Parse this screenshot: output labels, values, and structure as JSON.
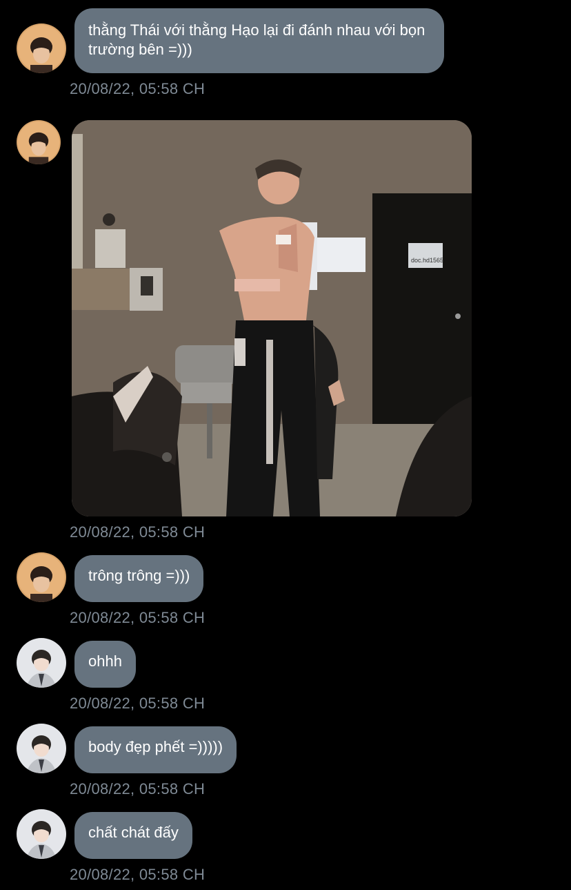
{
  "colors": {
    "background": "#000000",
    "bubble": "#66737f",
    "timestamp": "#7f8a95",
    "text": "#ffffff"
  },
  "messages": [
    {
      "sender": "avatar-orange",
      "text": "thằng Thái với thằng Hạo lại đi đánh nhau với bọn trường bên =)))",
      "timestamp": "20/08/22, 05:58 CH"
    },
    {
      "sender": "avatar-orange",
      "image": "photo",
      "timestamp": "20/08/22, 05:58 CH",
      "photo_sign_text": "doc.hd1565"
    },
    {
      "sender": "avatar-orange",
      "text": "trông trông =)))",
      "timestamp": "20/08/22, 05:58 CH"
    },
    {
      "sender": "avatar-grey",
      "text": "ohhh",
      "timestamp": "20/08/22, 05:58 CH"
    },
    {
      "sender": "avatar-grey",
      "text": "body đẹp phết =)))))",
      "timestamp": "20/08/22, 05:58 CH"
    },
    {
      "sender": "avatar-grey",
      "text": "chất chát đấy",
      "timestamp": "20/08/22, 05:58 CH"
    }
  ]
}
